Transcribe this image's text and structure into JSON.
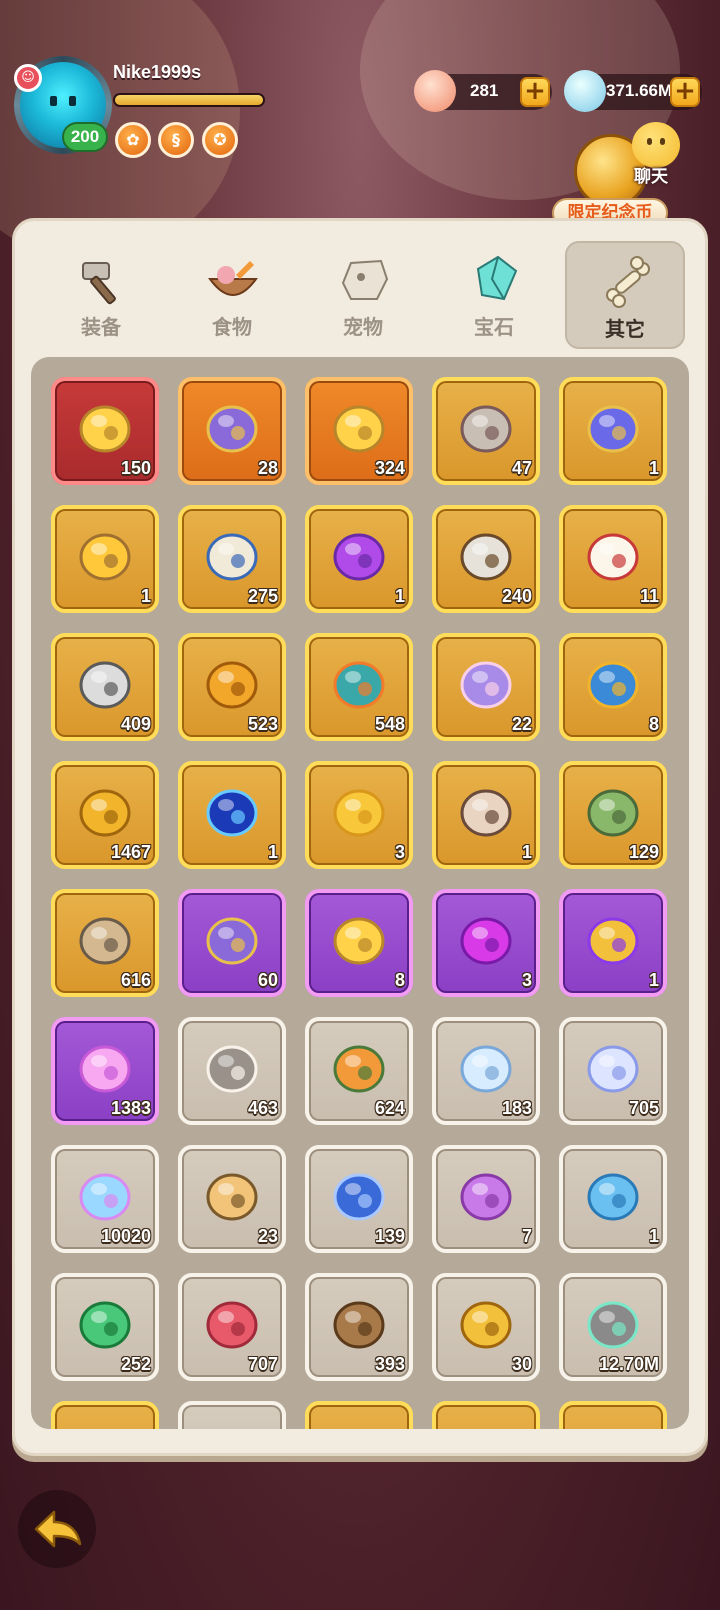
{
  "player": {
    "name": "Nike1999s",
    "level": "200",
    "xp_fraction": 1.0
  },
  "currencies": [
    {
      "name": "shell-coin",
      "value": "281",
      "color": "#f7a3a3"
    },
    {
      "name": "crystal",
      "value": "371.66M",
      "color": "#9fd8ef"
    }
  ],
  "event": {
    "label": "限定纪念币"
  },
  "chat": {
    "label": "聊天"
  },
  "tabs": [
    {
      "label": "装备",
      "icon": "hammer-icon",
      "active": false
    },
    {
      "label": "食物",
      "icon": "food-bowl-icon",
      "active": false
    },
    {
      "label": "宠物",
      "icon": "pet-skull-icon",
      "active": false
    },
    {
      "label": "宝石",
      "icon": "gem-icon",
      "active": false
    },
    {
      "label": "其它",
      "icon": "bone-icon",
      "active": true
    }
  ],
  "items": [
    {
      "icon": "gold-pet-chest-icon",
      "count": "150",
      "rarity": "red"
    },
    {
      "icon": "purple-orb-chest-icon",
      "count": "28",
      "rarity": "orange"
    },
    {
      "icon": "gold-pet-chest-icon",
      "count": "324",
      "rarity": "orange"
    },
    {
      "icon": "fossil-stone-icon",
      "count": "47",
      "rarity": "gold"
    },
    {
      "icon": "card-chest-icon",
      "count": "1",
      "rarity": "gold"
    },
    {
      "icon": "gold-ore-icon",
      "count": "1",
      "rarity": "gold"
    },
    {
      "icon": "horn-scroll-icon",
      "count": "275",
      "rarity": "gold"
    },
    {
      "icon": "purple-monster-bag-icon",
      "count": "1",
      "rarity": "gold"
    },
    {
      "icon": "pickaxe-icon",
      "count": "240",
      "rarity": "gold"
    },
    {
      "icon": "dice-icon",
      "count": "11",
      "rarity": "gold"
    },
    {
      "icon": "magnifier-icon",
      "count": "409",
      "rarity": "gold"
    },
    {
      "icon": "cake-coin-icon",
      "count": "523",
      "rarity": "gold"
    },
    {
      "icon": "carrot-bag-icon",
      "count": "548",
      "rarity": "gold"
    },
    {
      "icon": "bunny-bag-icon",
      "count": "22",
      "rarity": "gold"
    },
    {
      "icon": "gem-bag-icon",
      "count": "8",
      "rarity": "gold"
    },
    {
      "icon": "spiral-gold-coin-icon",
      "count": "1467",
      "rarity": "gold"
    },
    {
      "icon": "blue-dash-skill-icon",
      "count": "1",
      "rarity": "gold"
    },
    {
      "icon": "gold-egg-icon",
      "count": "3",
      "rarity": "gold"
    },
    {
      "icon": "caveman-portrait-icon",
      "count": "1",
      "rarity": "gold"
    },
    {
      "icon": "green-statue-icon",
      "count": "129",
      "rarity": "gold"
    },
    {
      "icon": "stone-statue-icon",
      "count": "616",
      "rarity": "gold"
    },
    {
      "icon": "purple-orb-chest-icon",
      "count": "60",
      "rarity": "purple"
    },
    {
      "icon": "gold-pet-chest-icon",
      "count": "8",
      "rarity": "purple"
    },
    {
      "icon": "purple-gem-icon",
      "count": "3",
      "rarity": "purple"
    },
    {
      "icon": "spiral-bag-icon",
      "count": "1",
      "rarity": "purple"
    },
    {
      "icon": "pink-crystal-icon",
      "count": "1383",
      "rarity": "purple"
    },
    {
      "icon": "stone-tablet-icon",
      "count": "463",
      "rarity": "white"
    },
    {
      "icon": "feast-plate-icon",
      "count": "624",
      "rarity": "white"
    },
    {
      "icon": "moon-shard-icon",
      "count": "183",
      "rarity": "white"
    },
    {
      "icon": "star-shard-icon",
      "count": "705",
      "rarity": "white"
    },
    {
      "icon": "rainbow-crystal-icon",
      "count": "10020",
      "rarity": "white"
    },
    {
      "icon": "seed-bag-icon",
      "count": "23",
      "rarity": "white"
    },
    {
      "icon": "blue-rune-stone-icon",
      "count": "139",
      "rarity": "white"
    },
    {
      "icon": "purple-ticket-icon",
      "count": "7",
      "rarity": "white"
    },
    {
      "icon": "blue-card-icon",
      "count": "1",
      "rarity": "white"
    },
    {
      "icon": "green-ticket-icon",
      "count": "252",
      "rarity": "white"
    },
    {
      "icon": "red-ticket-icon",
      "count": "707",
      "rarity": "white"
    },
    {
      "icon": "brown-ticket-icon",
      "count": "393",
      "rarity": "white"
    },
    {
      "icon": "shell-coin-icon",
      "count": "30",
      "rarity": "white"
    },
    {
      "icon": "swirl-stone-icon",
      "count": "12.70M",
      "rarity": "white"
    },
    {
      "icon": "item-icon",
      "count": "",
      "rarity": "gold"
    },
    {
      "icon": "item-icon",
      "count": "",
      "rarity": "white"
    },
    {
      "icon": "item-icon",
      "count": "",
      "rarity": "gold"
    },
    {
      "icon": "item-icon",
      "count": "",
      "rarity": "gold"
    },
    {
      "icon": "item-icon",
      "count": "",
      "rarity": "gold"
    }
  ],
  "back": {
    "icon": "back-arrow-icon"
  }
}
